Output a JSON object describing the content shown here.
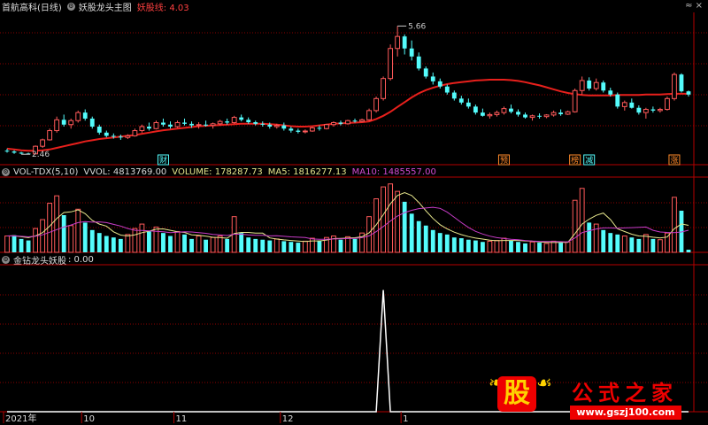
{
  "header": {
    "main_panel_stock": "首航高科(日线)",
    "main_panel_indicator": "妖股龙头主图",
    "main_panel_value_label": "妖股线: 4.03",
    "volume_panel_title": "VOL-TDX(5,10)",
    "volume_panel_vvol": "VVOL: 4813769.00",
    "volume_panel_volume": "VOLUME: 178287.73",
    "volume_panel_ma5": "MA5: 1816277.13",
    "volume_panel_ma10": "MA10: 1485557.00",
    "signal_panel_title": "金钻龙头妖股",
    "signal_panel_value": ": 0.00",
    "corner_icons": "≈ ×"
  },
  "colors": {
    "up": "#ff5a5a",
    "down": "#54fcfc",
    "ma_line": "#e8201c",
    "vol_ma5": "#e6e68c",
    "vol_ma10": "#c83cc8",
    "signal": "#ffffff",
    "grid": "#8a0000",
    "axis": "#b40000"
  },
  "chart_data": [
    {
      "type": "candlestick",
      "name": "main",
      "ylim": [
        2.2,
        6.0
      ],
      "annotations": [
        {
          "text": "5.66",
          "x": 55,
          "y": 5.66
        },
        {
          "text": "2.46",
          "x": 2,
          "y": 2.46
        }
      ],
      "tags": [
        {
          "text": "财",
          "x": 22
        },
        {
          "text": "预",
          "x": 70
        },
        {
          "text": "榜",
          "x": 80
        },
        {
          "text": "减",
          "x": 82
        },
        {
          "text": "涨",
          "x": 94
        }
      ],
      "candles": [
        [
          2.55,
          2.6,
          2.5,
          2.53
        ],
        [
          2.53,
          2.56,
          2.47,
          2.5
        ],
        [
          2.5,
          2.52,
          2.46,
          2.48
        ],
        [
          2.48,
          2.5,
          2.46,
          2.47
        ],
        [
          2.47,
          2.68,
          2.46,
          2.66
        ],
        [
          2.66,
          2.85,
          2.62,
          2.82
        ],
        [
          2.82,
          3.1,
          2.8,
          3.05
        ],
        [
          3.05,
          3.4,
          3.0,
          3.32
        ],
        [
          3.32,
          3.45,
          3.15,
          3.2
        ],
        [
          3.2,
          3.35,
          3.1,
          3.3
        ],
        [
          3.3,
          3.55,
          3.25,
          3.5
        ],
        [
          3.5,
          3.58,
          3.3,
          3.35
        ],
        [
          3.35,
          3.4,
          3.1,
          3.15
        ],
        [
          3.15,
          3.2,
          2.95,
          3.0
        ],
        [
          3.0,
          3.05,
          2.88,
          2.92
        ],
        [
          2.92,
          2.98,
          2.85,
          2.9
        ],
        [
          2.9,
          2.95,
          2.82,
          2.88
        ],
        [
          2.88,
          2.96,
          2.84,
          2.92
        ],
        [
          2.92,
          3.1,
          2.9,
          3.05
        ],
        [
          3.05,
          3.2,
          3.0,
          3.15
        ],
        [
          3.15,
          3.25,
          3.05,
          3.1
        ],
        [
          3.1,
          3.3,
          3.08,
          3.25
        ],
        [
          3.25,
          3.35,
          3.15,
          3.2
        ],
        [
          3.2,
          3.28,
          3.1,
          3.15
        ],
        [
          3.15,
          3.3,
          3.12,
          3.25
        ],
        [
          3.25,
          3.35,
          3.18,
          3.22
        ],
        [
          3.22,
          3.28,
          3.12,
          3.18
        ],
        [
          3.18,
          3.26,
          3.1,
          3.2
        ],
        [
          3.2,
          3.3,
          3.15,
          3.18
        ],
        [
          3.18,
          3.25,
          3.1,
          3.22
        ],
        [
          3.22,
          3.32,
          3.18,
          3.28
        ],
        [
          3.28,
          3.35,
          3.2,
          3.25
        ],
        [
          3.25,
          3.42,
          3.22,
          3.38
        ],
        [
          3.38,
          3.45,
          3.28,
          3.32
        ],
        [
          3.32,
          3.38,
          3.22,
          3.26
        ],
        [
          3.26,
          3.3,
          3.18,
          3.22
        ],
        [
          3.22,
          3.28,
          3.15,
          3.2
        ],
        [
          3.2,
          3.25,
          3.1,
          3.15
        ],
        [
          3.15,
          3.22,
          3.1,
          3.18
        ],
        [
          3.18,
          3.25,
          3.05,
          3.1
        ],
        [
          3.1,
          3.15,
          3.0,
          3.05
        ],
        [
          3.05,
          3.1,
          2.98,
          3.02
        ],
        [
          3.02,
          3.08,
          2.98,
          3.04
        ],
        [
          3.04,
          3.15,
          3.02,
          3.12
        ],
        [
          3.12,
          3.18,
          3.05,
          3.1
        ],
        [
          3.1,
          3.22,
          3.08,
          3.2
        ],
        [
          3.2,
          3.28,
          3.15,
          3.25
        ],
        [
          3.25,
          3.3,
          3.18,
          3.22
        ],
        [
          3.22,
          3.32,
          3.2,
          3.3
        ],
        [
          3.3,
          3.35,
          3.25,
          3.28
        ],
        [
          3.28,
          3.35,
          3.26,
          3.32
        ],
        [
          3.32,
          3.6,
          3.3,
          3.55
        ],
        [
          3.55,
          3.9,
          3.5,
          3.85
        ],
        [
          3.85,
          4.4,
          3.8,
          4.35
        ],
        [
          4.35,
          5.2,
          4.3,
          5.1
        ],
        [
          5.1,
          5.66,
          4.9,
          5.4
        ],
        [
          5.4,
          5.45,
          4.95,
          5.1
        ],
        [
          5.1,
          5.3,
          4.8,
          4.9
        ],
        [
          4.9,
          5.0,
          4.55,
          4.6
        ],
        [
          4.6,
          4.65,
          4.35,
          4.4
        ],
        [
          4.4,
          4.5,
          4.2,
          4.28
        ],
        [
          4.28,
          4.35,
          4.1,
          4.15
        ],
        [
          4.15,
          4.2,
          3.95,
          4.0
        ],
        [
          4.0,
          4.05,
          3.8,
          3.85
        ],
        [
          3.85,
          3.92,
          3.7,
          3.75
        ],
        [
          3.75,
          3.85,
          3.6,
          3.65
        ],
        [
          3.65,
          3.7,
          3.45,
          3.5
        ],
        [
          3.5,
          3.6,
          3.4,
          3.42
        ],
        [
          3.42,
          3.5,
          3.35,
          3.45
        ],
        [
          3.45,
          3.55,
          3.4,
          3.5
        ],
        [
          3.5,
          3.65,
          3.45,
          3.6
        ],
        [
          3.6,
          3.7,
          3.48,
          3.52
        ],
        [
          3.52,
          3.58,
          3.4,
          3.45
        ],
        [
          3.45,
          3.5,
          3.35,
          3.38
        ],
        [
          3.38,
          3.45,
          3.3,
          3.42
        ],
        [
          3.42,
          3.48,
          3.35,
          3.4
        ],
        [
          3.4,
          3.46,
          3.36,
          3.44
        ],
        [
          3.44,
          3.55,
          3.4,
          3.5
        ],
        [
          3.5,
          3.58,
          3.42,
          3.46
        ],
        [
          3.46,
          3.55,
          3.44,
          3.52
        ],
        [
          3.52,
          4.1,
          3.5,
          4.05
        ],
        [
          4.05,
          4.4,
          3.95,
          4.3
        ],
        [
          4.3,
          4.38,
          4.05,
          4.1
        ],
        [
          4.1,
          4.35,
          4.05,
          4.25
        ],
        [
          4.25,
          4.3,
          4.0,
          4.05
        ],
        [
          4.05,
          4.12,
          3.9,
          3.95
        ],
        [
          3.95,
          4.0,
          3.6,
          3.65
        ],
        [
          3.65,
          3.8,
          3.55,
          3.75
        ],
        [
          3.75,
          3.85,
          3.6,
          3.62
        ],
        [
          3.62,
          3.68,
          3.45,
          3.5
        ],
        [
          3.5,
          3.62,
          3.35,
          3.58
        ],
        [
          3.58,
          3.65,
          3.5,
          3.55
        ],
        [
          3.55,
          3.62,
          3.5,
          3.58
        ],
        [
          3.58,
          3.9,
          3.55,
          3.85
        ],
        [
          3.85,
          4.5,
          3.8,
          4.45
        ],
        [
          4.45,
          4.48,
          4.0,
          4.03
        ],
        [
          4.03,
          4.05,
          3.9,
          3.95
        ]
      ],
      "ma_line": [
        2.6,
        2.58,
        2.56,
        2.55,
        2.55,
        2.56,
        2.58,
        2.62,
        2.66,
        2.7,
        2.74,
        2.78,
        2.81,
        2.84,
        2.86,
        2.88,
        2.9,
        2.92,
        2.94,
        2.97,
        3.0,
        3.03,
        3.06,
        3.08,
        3.1,
        3.12,
        3.14,
        3.16,
        3.17,
        3.18,
        3.19,
        3.2,
        3.21,
        3.22,
        3.22,
        3.22,
        3.22,
        3.21,
        3.2,
        3.18,
        3.16,
        3.15,
        3.15,
        3.16,
        3.18,
        3.2,
        3.22,
        3.23,
        3.24,
        3.25,
        3.26,
        3.28,
        3.34,
        3.42,
        3.52,
        3.64,
        3.76,
        3.88,
        3.98,
        4.06,
        4.12,
        4.17,
        4.21,
        4.24,
        4.26,
        4.28,
        4.3,
        4.31,
        4.32,
        4.32,
        4.32,
        4.31,
        4.29,
        4.26,
        4.22,
        4.18,
        4.13,
        4.08,
        4.03,
        3.99,
        3.96,
        3.94,
        3.93,
        3.93,
        3.93,
        3.93,
        3.94,
        3.94,
        3.94,
        3.94,
        3.95,
        3.95,
        3.95,
        3.96,
        3.97,
        3.97,
        3.97
      ]
    },
    {
      "type": "bar",
      "name": "volume",
      "ylim": [
        0,
        5000000
      ],
      "up_flags": [
        1,
        0,
        0,
        0,
        1,
        1,
        1,
        1,
        0,
        1,
        1,
        0,
        0,
        0,
        0,
        0,
        0,
        1,
        1,
        1,
        0,
        1,
        0,
        0,
        1,
        0,
        0,
        1,
        0,
        1,
        1,
        0,
        1,
        0,
        0,
        0,
        0,
        0,
        1,
        0,
        0,
        0,
        1,
        1,
        0,
        1,
        1,
        0,
        1,
        0,
        1,
        1,
        1,
        1,
        1,
        1,
        0,
        0,
        0,
        0,
        0,
        0,
        0,
        0,
        0,
        0,
        0,
        0,
        1,
        1,
        1,
        0,
        0,
        0,
        1,
        0,
        1,
        1,
        0,
        1,
        1,
        1,
        0,
        1,
        0,
        0,
        0,
        1,
        0,
        0,
        1,
        0,
        1,
        1,
        1,
        0,
        0
      ],
      "values": [
        1100000,
        1150000,
        900000,
        800000,
        1600000,
        2200000,
        3300000,
        3800000,
        2500000,
        1800000,
        2900000,
        2000000,
        1500000,
        1300000,
        1100000,
        1000000,
        900000,
        1200000,
        1600000,
        1900000,
        1400000,
        1700000,
        1300000,
        1100000,
        1400000,
        1200000,
        900000,
        1100000,
        850000,
        1000000,
        1100000,
        900000,
        2400000,
        1300000,
        1000000,
        900000,
        850000,
        800000,
        900000,
        750000,
        700000,
        650000,
        750000,
        950000,
        800000,
        1000000,
        1100000,
        850000,
        1050000,
        900000,
        1300000,
        2400000,
        3600000,
        4400000,
        4600000,
        4100000,
        3400000,
        2600000,
        2100000,
        1800000,
        1500000,
        1300000,
        1200000,
        1000000,
        950000,
        850000,
        800000,
        700000,
        750000,
        800000,
        950000,
        800000,
        700000,
        600000,
        700000,
        650000,
        600000,
        750000,
        650000,
        700000,
        3500000,
        4300000,
        2000000,
        1900000,
        1500000,
        1300000,
        1200000,
        1100000,
        1000000,
        900000,
        1200000,
        900000,
        850000,
        1300000,
        3700000,
        2800000,
        178287.73
      ],
      "ma5": [
        1100000,
        1120000,
        1050000,
        990000,
        1110000,
        1330000,
        1760000,
        2280000,
        2680000,
        2720000,
        2860000,
        2600000,
        2140000,
        1900000,
        1760000,
        1380000,
        1160000,
        1100000,
        1180000,
        1320000,
        1420000,
        1560000,
        1580000,
        1480000,
        1380000,
        1340000,
        1180000,
        1140000,
        1090000,
        1010000,
        990000,
        950000,
        1270000,
        1340000,
        1340000,
        1300000,
        1290000,
        970000,
        890000,
        840000,
        800000,
        760000,
        730000,
        770000,
        770000,
        830000,
        920000,
        940000,
        960000,
        980000,
        1050000,
        1310000,
        1850000,
        2530000,
        3260000,
        3820000,
        4020000,
        3820000,
        3360000,
        2800000,
        2280000,
        1860000,
        1580000,
        1360000,
        1190000,
        1060000,
        960000,
        890000,
        820000,
        780000,
        800000,
        800000,
        800000,
        770000,
        750000,
        700000,
        670000,
        660000,
        670000,
        670000,
        1260000,
        1900000,
        2230000,
        2490000,
        2640000,
        2200000,
        1580000,
        1400000,
        1220000,
        1100000,
        1080000,
        1020000,
        970000,
        1030000,
        1590000,
        1910000,
        1818000
      ],
      "ma10": [
        1100000,
        1110000,
        1080000,
        1040000,
        1090000,
        1180000,
        1350000,
        1530000,
        1700000,
        1840000,
        2000000,
        2070000,
        2030000,
        2050000,
        2000000,
        1880000,
        1770000,
        1600000,
        1480000,
        1470000,
        1440000,
        1410000,
        1380000,
        1330000,
        1360000,
        1380000,
        1370000,
        1330000,
        1280000,
        1200000,
        1170000,
        1130000,
        1220000,
        1220000,
        1180000,
        1150000,
        1140000,
        1110000,
        1120000,
        1080000,
        1040000,
        1020000,
        1000000,
        900000,
        880000,
        880000,
        900000,
        910000,
        930000,
        940000,
        990000,
        1110000,
        1390000,
        1740000,
        2110000,
        2440000,
        2670000,
        2830000,
        2940000,
        2980000,
        3030000,
        2960000,
        2700000,
        2360000,
        2000000,
        1670000,
        1410000,
        1230000,
        1090000,
        990000,
        930000,
        880000,
        850000,
        800000,
        760000,
        740000,
        730000,
        730000,
        720000,
        700000,
        970000,
        1330000,
        1450000,
        1570000,
        1640000,
        1640000,
        1620000,
        1640000,
        1660000,
        1680000,
        1700000,
        1480000,
        1370000,
        1340000,
        1330000,
        1370000,
        1485557
      ]
    },
    {
      "type": "line",
      "name": "signal",
      "ylim": [
        0,
        1.2
      ],
      "values": [
        0,
        0,
        0,
        0,
        0,
        0,
        0,
        0,
        0,
        0,
        0,
        0,
        0,
        0,
        0,
        0,
        0,
        0,
        0,
        0,
        0,
        0,
        0,
        0,
        0,
        0,
        0,
        0,
        0,
        0,
        0,
        0,
        0,
        0,
        0,
        0,
        0,
        0,
        0,
        0,
        0,
        0,
        0,
        0,
        0,
        0,
        0,
        0,
        0,
        0,
        0,
        0,
        0,
        1,
        0,
        0,
        0,
        0,
        0,
        0,
        0,
        0,
        0,
        0,
        0,
        0,
        0,
        0,
        0,
        0,
        0,
        0,
        0,
        0,
        0,
        0,
        0,
        0,
        0,
        0,
        0,
        0,
        0,
        0,
        0,
        0,
        0,
        0,
        0,
        0,
        0,
        0,
        0,
        0,
        0,
        0,
        0
      ]
    }
  ],
  "x_axis": {
    "labels": [
      {
        "text": "2021年",
        "x": 0
      },
      {
        "text": "10",
        "x": 11
      },
      {
        "text": "11",
        "x": 24
      },
      {
        "text": "12",
        "x": 39
      },
      {
        "text": "1",
        "x": 56
      }
    ]
  },
  "logo": {
    "char": "股",
    "name": "公式之家",
    "url": "www.gszj100.com"
  }
}
